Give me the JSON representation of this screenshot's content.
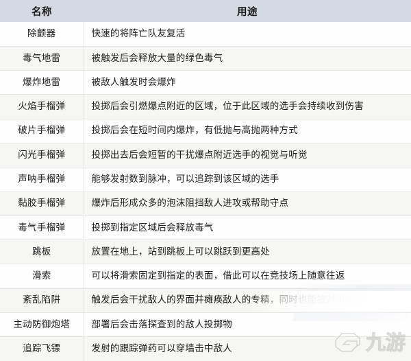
{
  "table": {
    "columns": [
      {
        "key": "name",
        "label": "名称"
      },
      {
        "key": "use",
        "label": "用途"
      }
    ],
    "rows": [
      {
        "name": "除颤器",
        "use": "快速的将阵亡队友复活"
      },
      {
        "name": "毒气地雷",
        "use": "被触发后会释放大量的绿色毒气"
      },
      {
        "name": "爆炸地雷",
        "use": "被敌人触发时会爆炸"
      },
      {
        "name": "火焰手榴弹",
        "use": "投掷后会引燃爆点附近的区域，位于此区域的选手会持续收到伤害"
      },
      {
        "name": "破片手榴弹",
        "use": "投掷后会在短时间内爆炸，有低抛与高抛两种方式"
      },
      {
        "name": "闪光手榴弹",
        "use": "投掷出去后会短暂的干扰爆点附近选手的视觉与听觉"
      },
      {
        "name": "声呐手榴弹",
        "use": "能够发射数到脉冲，可以追踪到该区域的选手"
      },
      {
        "name": "黏胶手榴弹",
        "use": "爆炸后形成众多的泡沫阻挡敌人进攻或帮助守点"
      },
      {
        "name": "毒气手榴弹",
        "use": "投掷到指定区域后会释放毒气"
      },
      {
        "name": "跳板",
        "use": "放置在地上，站到跳板上可以跳跃到更高处"
      },
      {
        "name": "滑索",
        "use": "可以将滑索固定到指定的表面，借此可以在竞技场上随意往返"
      },
      {
        "name": "紊乱陷阱",
        "use": "触发后会干扰敌人的界面并瘫痪敌人的专精，同时也能被对手破坏"
      },
      {
        "name": "主动防御炮塔",
        "use": "部署后会击落探查到的敌人投掷物"
      },
      {
        "name": "追踪飞镖",
        "use": "发射的跟踪弹药可以穿墙击中敌人"
      }
    ]
  },
  "watermark": {
    "logo_icon": "jiuyou-g-logo-icon",
    "text": "九游"
  },
  "colors": {
    "header_bg": "#d5d9e2",
    "row_odd_bg": "#fefefe",
    "row_even_bg": "#f6f6f4",
    "border": "#e6e6e4",
    "text": "#1d1d1d"
  }
}
